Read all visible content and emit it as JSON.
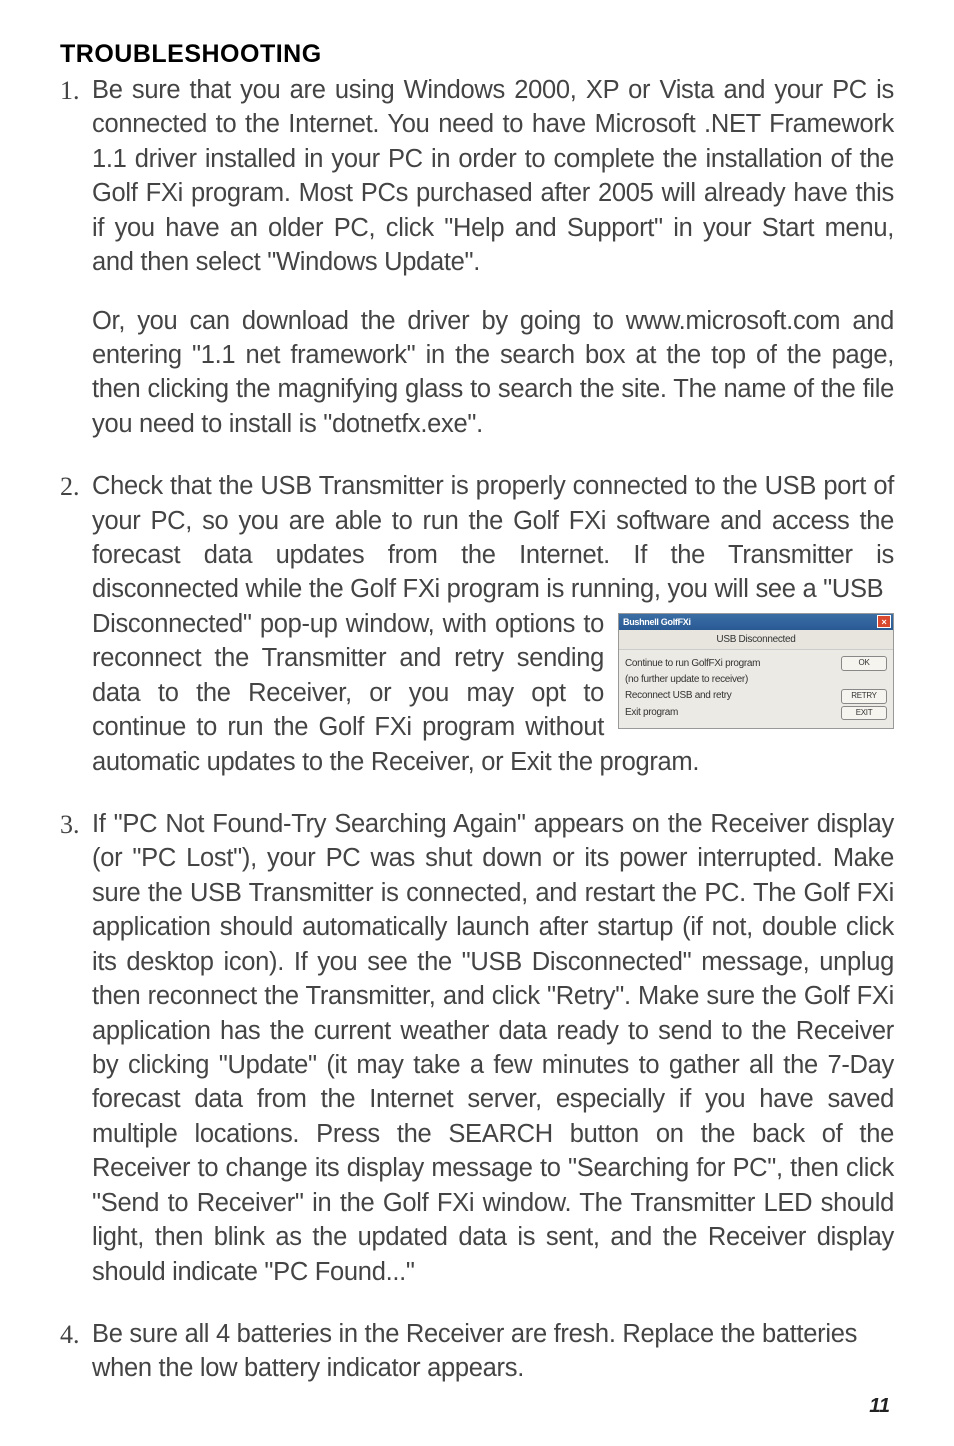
{
  "heading": "TROUBLESHOOTING",
  "items": [
    {
      "num": "1.",
      "paras": [
        "Be sure that you are using Windows 2000, XP or Vista and your PC is connected to the Internet. You need to have Microsoft .NET Framework 1.1 driver installed in your PC in order to complete the installation of the Golf FXi program. Most PCs purchased after 2005 will already have this if you have an older PC, click \"Help and Support\" in your Start menu, and then select \"Windows Update\".",
        "Or, you can download the driver by going to www.microsoft.com and entering \"1.1 net framework\" in the search box at the top of the page, then clicking the magnifying glass to search the site. The name of the file you need to install is \"dotnetfx.exe\"."
      ]
    },
    {
      "num": "2.",
      "lead": "Check that the USB Transmitter is properly connected to the USB port of your PC, so you are able to run the Golf FXi software and access the forecast data updates from the Internet. If the Transmitter is disconnected while the Golf FXi program is running, you will see a \"USB",
      "wrap": "Disconnected\" pop-up window, with options to reconnect the Transmitter and retry sending data to the Receiver, or you may opt to continue to run the Golf FXi program without automatic updates to the Receiver, or Exit the program."
    },
    {
      "num": "3.",
      "paras": [
        "If \"PC Not Found-Try Searching Again\" appears on the Receiver display (or \"PC Lost\"), your PC was shut down or its power interrupted. Make sure the USB Transmitter is connected, and restart the PC. The Golf FXi application should automatically launch after startup (if not, double click its desktop icon). If you see the \"USB Disconnected\" message, unplug then reconnect the Transmitter, and click \"Retry\". Make sure the Golf FXi application has the current weather data ready to send to the Receiver by clicking \"Update\" (it may take a few minutes to gather all the 7-Day forecast data from the Internet server, especially if you have saved multiple locations. Press the SEARCH button on the back of the Receiver to change its display message to \"Searching for PC\", then click \"Send to Receiver\" in the Golf FXi window. The Transmitter LED should light, then blink as the updated data is sent, and the Receiver display should indicate \"PC Found...\""
      ]
    },
    {
      "num": "4.",
      "paras": [
        "Be sure all 4 batteries in the Receiver are fresh. Replace the batteries when the low battery indicator appears."
      ]
    }
  ],
  "dialog": {
    "title": "Bushnell GolfFXi",
    "sub": "USB Disconnected",
    "line1": "Continue to run GolfFXi program",
    "line2": "(no further update to receiver)",
    "line3": "Reconnect USB and retry",
    "line4": "Exit program",
    "ok": "OK",
    "retry": "RETRY",
    "exit": "EXIT"
  },
  "page": "11"
}
